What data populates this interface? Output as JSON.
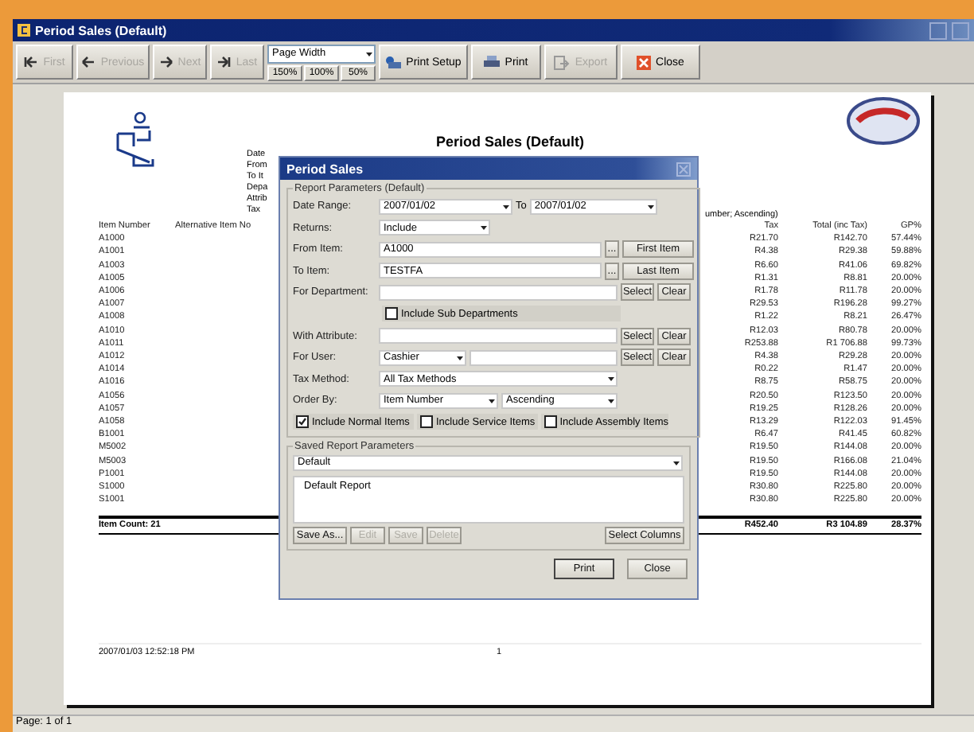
{
  "window": {
    "title": "Period Sales (Default)"
  },
  "toolbar": {
    "nav": [
      {
        "label": "First",
        "disabled": true
      },
      {
        "label": "Previous",
        "disabled": true
      },
      {
        "label": "Next",
        "disabled": true
      },
      {
        "label": "Last",
        "disabled": true
      }
    ],
    "zoom": {
      "value": "Page Width",
      "presets": [
        "150%",
        "100%",
        "50%"
      ]
    },
    "actions": [
      {
        "label": "Print Setup",
        "disabled": false
      },
      {
        "label": "Print",
        "disabled": false
      },
      {
        "label": "Export",
        "disabled": true
      },
      {
        "label": "Close",
        "disabled": false
      }
    ]
  },
  "report": {
    "title": "Period Sales (Default)",
    "header_lines": [
      "Date",
      "From",
      "To It",
      "Depa",
      "Attrib",
      "Tax"
    ],
    "sort_text": "umber; Ascending)",
    "left_columns": [
      "Item Number",
      "Alternative Item No"
    ],
    "right_columns": [
      "Tax",
      "Total (inc Tax)",
      "GP%"
    ],
    "rows": [
      {
        "item": "A1000",
        "tax": "R21.70",
        "total": "R142.70",
        "gp": "57.44%"
      },
      {
        "item": "A1001",
        "tax": "R4.38",
        "total": "R29.38",
        "gp": "59.88%"
      },
      {
        "item": "A1003",
        "tax": "R6.60",
        "total": "R41.06",
        "gp": "69.82%"
      },
      {
        "item": "A1005",
        "tax": "R1.31",
        "total": "R8.81",
        "gp": "20.00%"
      },
      {
        "item": "A1006",
        "tax": "R1.78",
        "total": "R11.78",
        "gp": "20.00%"
      },
      {
        "item": "A1007",
        "tax": "R29.53",
        "total": "R196.28",
        "gp": "99.27%"
      },
      {
        "item": "A1008",
        "tax": "R1.22",
        "total": "R8.21",
        "gp": "26.47%"
      },
      {
        "item": "A1010",
        "tax": "R12.03",
        "total": "R80.78",
        "gp": "20.00%"
      },
      {
        "item": "A1011",
        "tax": "R253.88",
        "total": "R1 706.88",
        "gp": "99.73%"
      },
      {
        "item": "A1012",
        "tax": "R4.38",
        "total": "R29.28",
        "gp": "20.00%"
      },
      {
        "item": "A1014",
        "tax": "R0.22",
        "total": "R1.47",
        "gp": "20.00%"
      },
      {
        "item": "A1016",
        "tax": "R8.75",
        "total": "R58.75",
        "gp": "20.00%"
      },
      {
        "item": "A1056",
        "tax": "R20.50",
        "total": "R123.50",
        "gp": "20.00%"
      },
      {
        "item": "A1057",
        "tax": "R19.25",
        "total": "R128.26",
        "gp": "20.00%"
      },
      {
        "item": "A1058",
        "tax": "R13.29",
        "total": "R122.03",
        "gp": "91.45%"
      },
      {
        "item": "B1001",
        "tax": "R6.47",
        "total": "R41.45",
        "gp": "60.82%"
      },
      {
        "item": "M5002",
        "tax": "R19.50",
        "total": "R144.08",
        "gp": "20.00%"
      },
      {
        "item": "M5003",
        "tax": "R19.50",
        "total": "R166.08",
        "gp": "21.04%"
      },
      {
        "item": "P1001",
        "tax": "R19.50",
        "total": "R144.08",
        "gp": "20.00%"
      },
      {
        "item": "S1000",
        "tax": "R30.80",
        "total": "R225.80",
        "gp": "20.00%"
      },
      {
        "item": "S1001",
        "tax": "R30.80",
        "total": "R225.80",
        "gp": "20.00%"
      }
    ],
    "count": "Item Count: 21",
    "totals": {
      "tax": "R452.40",
      "total": "R3 104.89",
      "gp": "28.37%"
    },
    "footer": {
      "printed": "2007/01/03 12:52:18 PM",
      "page": "1"
    }
  },
  "dialog": {
    "title": "Period Sales",
    "group": "Report Parameters (Default)",
    "rows": [
      {
        "kind": "date",
        "label": "Date Range:",
        "value": "2007/01/02",
        "to_label": "To",
        "to_value": "2007/01/02"
      },
      {
        "kind": "short_select",
        "label": "Returns:",
        "value": "Include"
      },
      {
        "kind": "item",
        "label": "From Item:",
        "value": "A1000",
        "more": "...",
        "button": "First Item"
      },
      {
        "kind": "item",
        "label": "To Item:",
        "value": "TESTFA",
        "more": "...",
        "button": "Last Item"
      },
      {
        "kind": "lookup",
        "label": "For Department:",
        "buttons": [
          "Select",
          "Clear"
        ]
      },
      {
        "kind": "checkbox",
        "label": "Include Sub Departments",
        "checked": false
      },
      {
        "kind": "lookup",
        "label": "With Attribute:",
        "buttons": [
          "Select",
          "Clear"
        ]
      },
      {
        "kind": "user",
        "label": "For User:",
        "value": "Cashier",
        "buttons": [
          "Select",
          "Clear"
        ]
      },
      {
        "kind": "select",
        "label": "Tax Method:",
        "value": "All Tax Methods"
      },
      {
        "kind": "order",
        "label": "Order By:",
        "value": "Item Number",
        "direction": "Ascending"
      }
    ],
    "item_types": [
      {
        "label": "Include Normal Items",
        "checked": true
      },
      {
        "label": "Include Service Items",
        "checked": false
      },
      {
        "label": "Include Assembly Items",
        "checked": false
      }
    ],
    "saved": {
      "title": "Saved Report Parameters",
      "value": "Default",
      "description": "Default Report",
      "buttons": [
        {
          "label": "Save As...",
          "disabled": false
        },
        {
          "label": "Edit",
          "disabled": true
        },
        {
          "label": "Save",
          "disabled": true
        },
        {
          "label": "Delete",
          "disabled": true
        }
      ],
      "columns_button": "Select Columns"
    },
    "buttons": [
      {
        "label": "Print",
        "default": true
      },
      {
        "label": "Close",
        "default": false
      }
    ]
  },
  "status_bar": "Page: 1 of 1"
}
